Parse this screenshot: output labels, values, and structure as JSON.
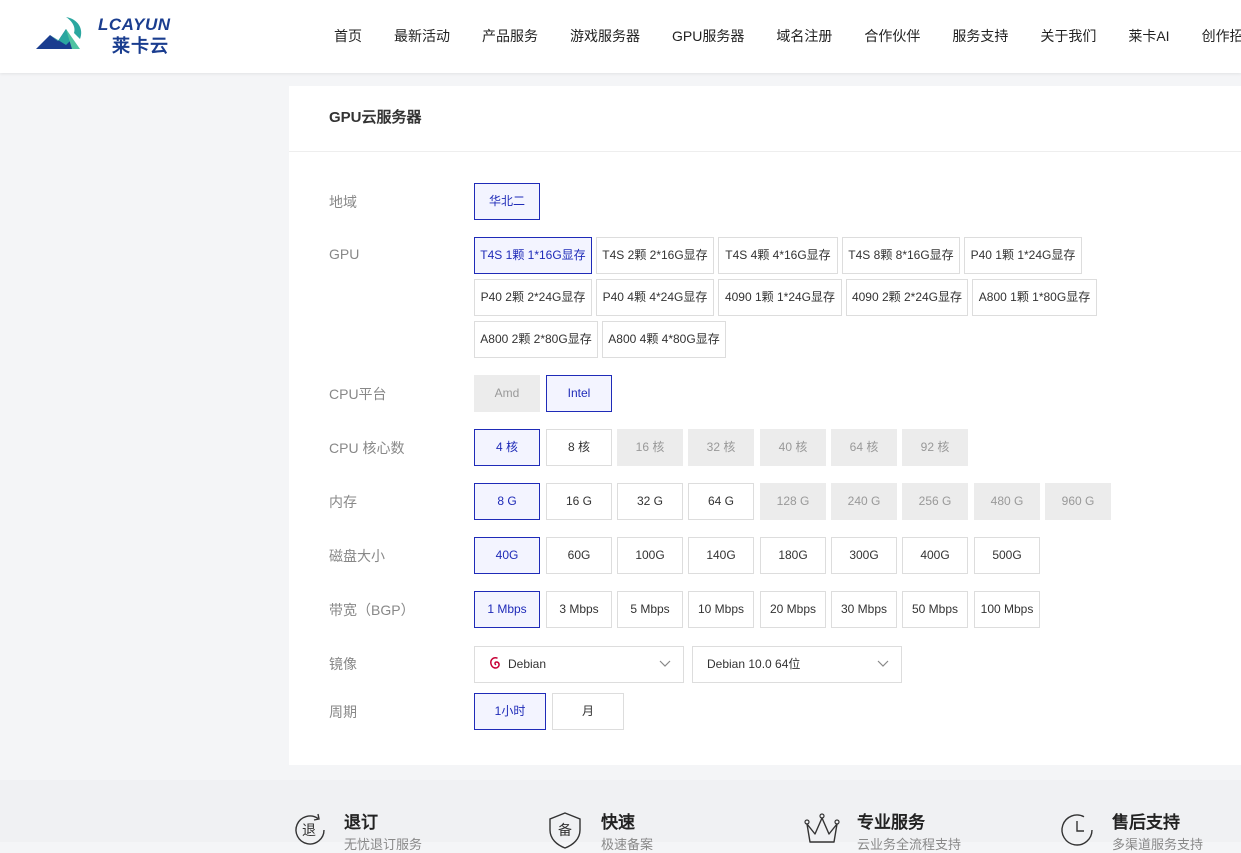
{
  "brand": {
    "name_en": "LCAYUN",
    "name_cn": "莱卡云",
    "primary_color": "#1a3d8f",
    "accent_color": "#1f2bb8"
  },
  "nav": {
    "items": [
      "首页",
      "最新活动",
      "产品服务",
      "游戏服务器",
      "GPU服务器",
      "域名注册",
      "合作伙伴",
      "服务支持",
      "关于我们",
      "莱卡AI",
      "创作招募"
    ]
  },
  "panel": {
    "title": "GPU云服务器"
  },
  "form": {
    "region": {
      "label": "地域",
      "options": [
        "华北二"
      ],
      "selected": "华北二"
    },
    "gpu": {
      "label": "GPU",
      "options": [
        "T4S 1颗 1*16G显存",
        "T4S 2颗 2*16G显存",
        "T4S 4颗 4*16G显存",
        "T4S 8颗 8*16G显存",
        "P40 1颗 1*24G显存",
        "P40 2颗 2*24G显存",
        "P40 4颗 4*24G显存",
        "4090 1颗 1*24G显存",
        "4090 2颗 2*24G显存",
        "A800 1颗 1*80G显存",
        "A800 2颗 2*80G显存",
        "A800 4颗 4*80G显存"
      ],
      "selected": "T4S 1颗 1*16G显存"
    },
    "cpu_platform": {
      "label": "CPU平台",
      "options": [
        "Amd",
        "Intel"
      ],
      "selected": "Intel",
      "disabled": [
        "Amd"
      ]
    },
    "cpu_cores": {
      "label": "CPU 核心数",
      "options": [
        "4 核",
        "8 核",
        "16 核",
        "32 核",
        "40 核",
        "64 核",
        "92 核"
      ],
      "selected": "4 核",
      "disabled": [
        "16 核",
        "32 核",
        "40 核",
        "64 核",
        "92 核"
      ]
    },
    "memory": {
      "label": "内存",
      "options": [
        "8 G",
        "16 G",
        "32 G",
        "64 G",
        "128 G",
        "240 G",
        "256 G",
        "480 G",
        "960 G"
      ],
      "selected": "8 G",
      "disabled": [
        "128 G",
        "240 G",
        "256 G",
        "480 G",
        "960 G"
      ]
    },
    "disk": {
      "label": "磁盘大小",
      "options": [
        "40G",
        "60G",
        "100G",
        "140G",
        "180G",
        "300G",
        "400G",
        "500G"
      ],
      "selected": "40G"
    },
    "bandwidth": {
      "label": "带宽（BGP）",
      "options": [
        "1 Mbps",
        "3 Mbps",
        "5 Mbps",
        "10 Mbps",
        "20 Mbps",
        "30 Mbps",
        "50 Mbps",
        "100 Mbps"
      ],
      "selected": "1 Mbps"
    },
    "image": {
      "label": "镜像",
      "os": "Debian",
      "version": "Debian 10.0 64位",
      "os_icon": "debian-icon"
    },
    "period": {
      "label": "周期",
      "options": [
        "1小时",
        "月"
      ],
      "selected": "1小时"
    }
  },
  "features": [
    {
      "title": "退订",
      "subtitle": "无忧退订服务",
      "icon": "refund-icon",
      "icon_char": "退"
    },
    {
      "title": "快速",
      "subtitle": "极速备案",
      "icon": "record-shield-icon",
      "icon_char": "备"
    },
    {
      "title": "专业服务",
      "subtitle": "云业务全流程支持",
      "icon": "crown-icon"
    },
    {
      "title": "售后支持",
      "subtitle": "多渠道服务支持",
      "icon": "clock-icon"
    }
  ]
}
